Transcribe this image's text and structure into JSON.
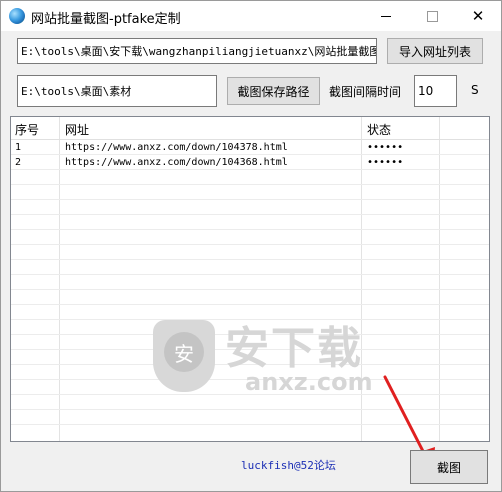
{
  "window": {
    "title": "网站批量截图-ptfake定制",
    "minimize_glyph": "—",
    "maximize_glyph": "☐",
    "close_glyph": "✕"
  },
  "url_list": {
    "path_value": "E:\\tools\\桌面\\安下载\\wangzhanpiliangjietuanxz\\网站批量截图\\网",
    "import_button": "导入网址列表"
  },
  "save_path": {
    "path_value": "E:\\tools\\桌面\\素材",
    "button": "截图保存路径"
  },
  "interval": {
    "label": "截图间隔时间",
    "value": "10",
    "unit": "S"
  },
  "table": {
    "headers": [
      "序号",
      "网址",
      "状态"
    ],
    "rows": [
      {
        "index": "1",
        "url": "https://www.anxz.com/down/104378.html",
        "status": "••••••"
      },
      {
        "index": "2",
        "url": "https://www.anxz.com/down/104368.html",
        "status": "••••••"
      }
    ]
  },
  "watermark": {
    "text_cn": "安下载",
    "text_en": "anxz.com",
    "shield_glyph": "安"
  },
  "footer": {
    "credit": "luckfish@52论坛",
    "capture_button": "截图"
  },
  "colors": {
    "credit_text": "#1c2fb5",
    "arrow": "#e02020"
  }
}
